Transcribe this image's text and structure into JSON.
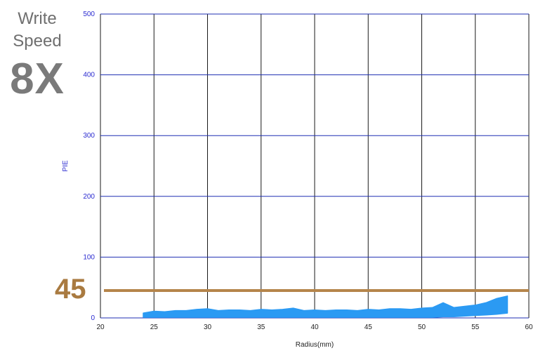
{
  "side_panel": {
    "title_line1": "Write",
    "title_line2": "Speed",
    "speed": "8X"
  },
  "colors": {
    "grid": "#1a1a1a",
    "hgrid": "#1f2fb3",
    "y_tick": "#2a2ad0",
    "x_tick": "#222222",
    "series": "#2b9af3",
    "threshold": "#b5854b"
  },
  "chart_data": {
    "type": "area",
    "xlabel": "Radius(mm)",
    "ylabel": "PIE",
    "xlim": [
      20,
      60
    ],
    "ylim": [
      0,
      500
    ],
    "xticks": [
      20,
      25,
      30,
      35,
      40,
      45,
      50,
      55,
      60
    ],
    "yticks": [
      0,
      100,
      200,
      300,
      400,
      500
    ],
    "grid": true,
    "threshold": {
      "label": "45",
      "value": 45
    },
    "series": [
      {
        "x": [
          24,
          25,
          26,
          27,
          28,
          29,
          30,
          31,
          32,
          33,
          34,
          35,
          36,
          37,
          38,
          39,
          40,
          41,
          42,
          43,
          44,
          45,
          46,
          47,
          48,
          49,
          50,
          51,
          52,
          53,
          54,
          55,
          56,
          57,
          58
        ],
        "upper": [
          8,
          11,
          10,
          12,
          12,
          14,
          15,
          12,
          13,
          13,
          12,
          14,
          13,
          14,
          16,
          12,
          13,
          12,
          13,
          13,
          12,
          14,
          13,
          15,
          15,
          14,
          16,
          17,
          25,
          17,
          19,
          21,
          25,
          32,
          36
        ],
        "lower": [
          1,
          1,
          1,
          1,
          1,
          1,
          1,
          1,
          1,
          1,
          1,
          1,
          1,
          1,
          1,
          1,
          1,
          1,
          1,
          1,
          1,
          1,
          1,
          1,
          1,
          1,
          1,
          1,
          2,
          2,
          3,
          4,
          5,
          6,
          8
        ]
      }
    ]
  }
}
